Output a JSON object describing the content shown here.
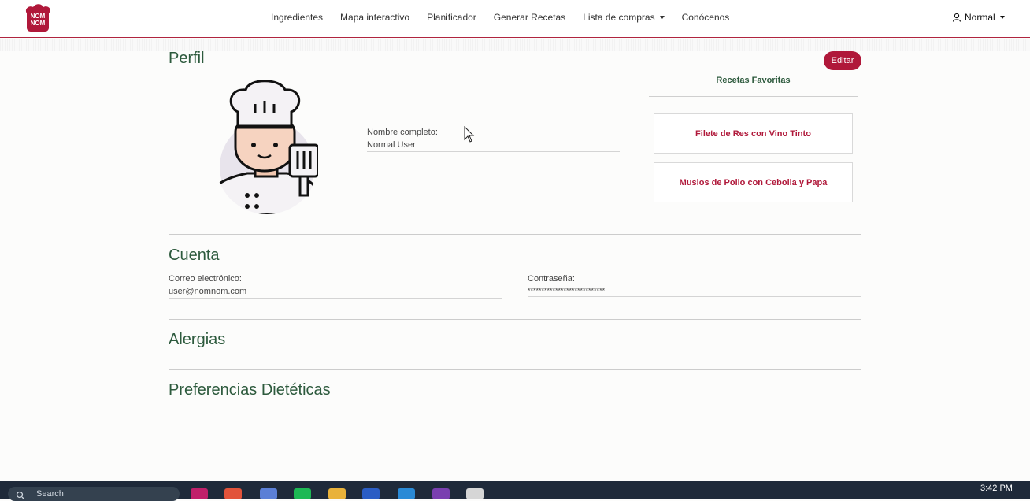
{
  "nav": {
    "brand": "NOM NOM",
    "links": [
      "Ingredientes",
      "Mapa interactivo",
      "Planificador",
      "Generar Recetas",
      "Lista de compras",
      "Conócenos"
    ],
    "user_label": "Normal"
  },
  "profile": {
    "title": "Perfil",
    "edit_label": "Editar",
    "full_name_label": "Nombre completo:",
    "full_name_value": "Normal User",
    "favs_title": "Recetas Favoritas",
    "favorites": [
      "Filete de Res con Vino Tinto",
      "Muslos de Pollo con Cebolla y Papa"
    ]
  },
  "account": {
    "title": "Cuenta",
    "email_label": "Correo electrónico:",
    "email_value": "user@nomnom.com",
    "password_label": "Contraseña:",
    "password_value": "****************************"
  },
  "allergies": {
    "title": "Alergias"
  },
  "diet": {
    "title": "Preferencias Dietéticas"
  },
  "taskbar": {
    "search": "Search",
    "time": "3:42 PM"
  },
  "colors": {
    "brand": "#b0183a",
    "heading": "#2d5a3d"
  }
}
